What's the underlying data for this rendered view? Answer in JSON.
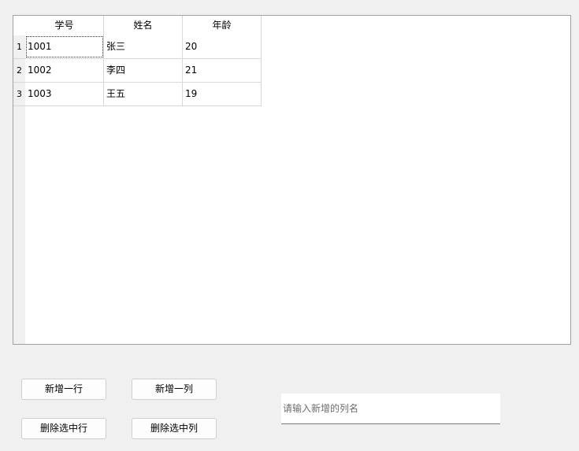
{
  "table": {
    "columns": [
      "学号",
      "姓名",
      "年龄"
    ],
    "rows": [
      {
        "num": "1",
        "cells": [
          "1001",
          "张三",
          "20"
        ]
      },
      {
        "num": "2",
        "cells": [
          "1002",
          "李四",
          "21"
        ]
      },
      {
        "num": "3",
        "cells": [
          "1003",
          "王五",
          "19"
        ]
      }
    ]
  },
  "buttons": {
    "add_row": "新增一行",
    "add_col": "新增一列",
    "delete_row": "删除选中行",
    "delete_col": "删除选中列"
  },
  "column_name_input": {
    "value": "",
    "placeholder": "请输入新增的列名"
  }
}
